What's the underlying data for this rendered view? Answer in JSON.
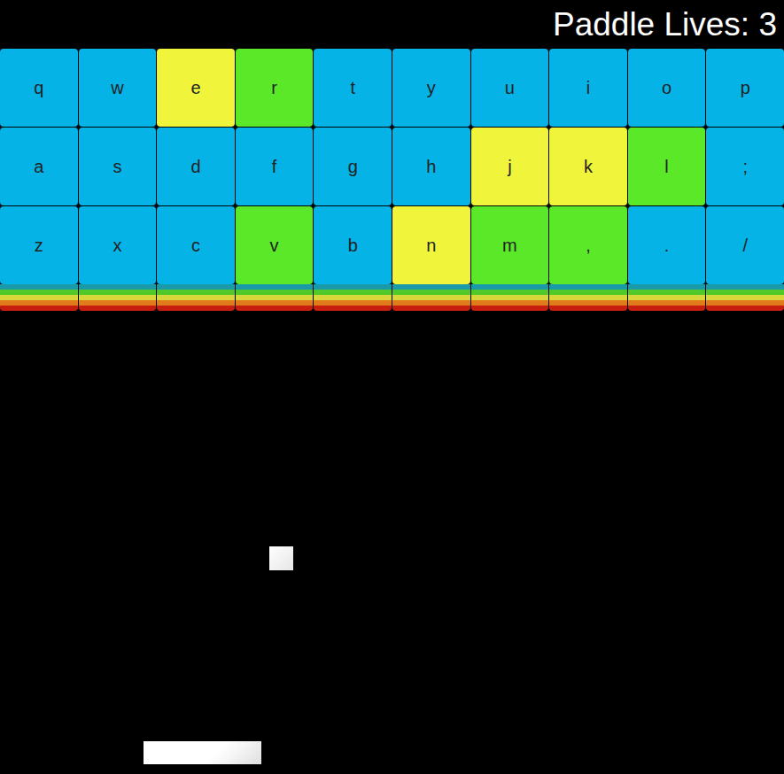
{
  "hud": {
    "lives_label": "Paddle Lives:",
    "lives": "3"
  },
  "bricks": [
    [
      {
        "label": "q",
        "color": "#05b3e6"
      },
      {
        "label": "w",
        "color": "#05b3e6"
      },
      {
        "label": "e",
        "color": "#f0f53c"
      },
      {
        "label": "r",
        "color": "#5ae828"
      },
      {
        "label": "t",
        "color": "#05b3e6"
      },
      {
        "label": "y",
        "color": "#05b3e6"
      },
      {
        "label": "u",
        "color": "#05b3e6"
      },
      {
        "label": "i",
        "color": "#05b3e6"
      },
      {
        "label": "o",
        "color": "#05b3e6"
      },
      {
        "label": "p",
        "color": "#05b3e6"
      }
    ],
    [
      {
        "label": "a",
        "color": "#05b3e6"
      },
      {
        "label": "s",
        "color": "#05b3e6"
      },
      {
        "label": "d",
        "color": "#05b3e6"
      },
      {
        "label": "f",
        "color": "#05b3e6"
      },
      {
        "label": "g",
        "color": "#05b3e6"
      },
      {
        "label": "h",
        "color": "#05b3e6"
      },
      {
        "label": "j",
        "color": "#f0f53c"
      },
      {
        "label": "k",
        "color": "#f0f53c"
      },
      {
        "label": "l",
        "color": "#5ae828"
      },
      {
        "label": ";",
        "color": "#05b3e6"
      }
    ],
    [
      {
        "label": "z",
        "color": "#05b3e6"
      },
      {
        "label": "x",
        "color": "#05b3e6"
      },
      {
        "label": "c",
        "color": "#05b3e6"
      },
      {
        "label": "v",
        "color": "#5ae828"
      },
      {
        "label": "b",
        "color": "#05b3e6"
      },
      {
        "label": "n",
        "color": "#f0f53c"
      },
      {
        "label": "m",
        "color": "#5ae828"
      },
      {
        "label": ",",
        "color": "#5ae828"
      },
      {
        "label": ".",
        "color": "#05b3e6"
      },
      {
        "label": "/",
        "color": "#05b3e6"
      }
    ]
  ]
}
